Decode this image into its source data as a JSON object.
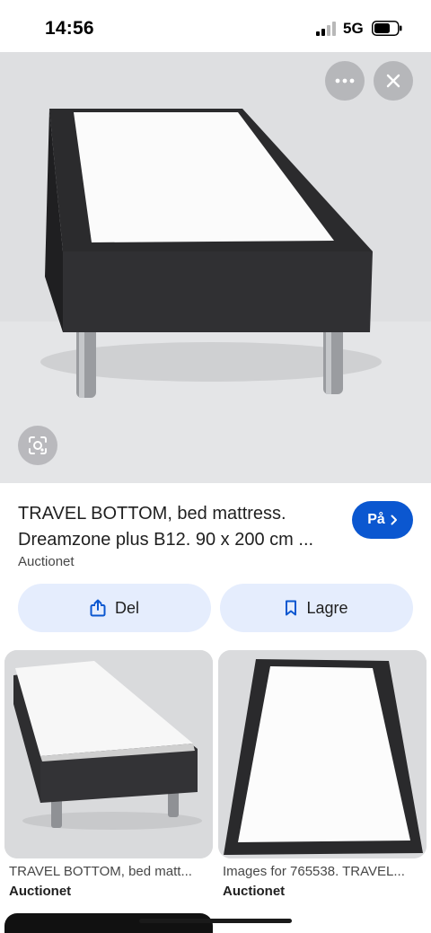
{
  "status_bar": {
    "time": "14:56",
    "network": "5G",
    "icons": [
      "signal-icon",
      "battery-icon"
    ]
  },
  "hero": {
    "icons": [
      "more-icon",
      "close-icon",
      "lens-icon"
    ]
  },
  "result": {
    "title_line1": "TRAVEL BOTTOM, bed mattress.",
    "title_line2": "Dreamzone plus B12. 90 x 200 cm ...",
    "source": "Auctionet",
    "visit_label": "På"
  },
  "actions": {
    "share_label": "Del",
    "save_label": "Lagre"
  },
  "related": [
    {
      "caption": "TRAVEL BOTTOM, bed matt...",
      "source": "Auctionet"
    },
    {
      "caption": "Images for 765538. TRAVEL...",
      "source": "Auctionet"
    }
  ],
  "colors": {
    "accent": "#0b57d0",
    "chip_background": "#e5edfd"
  }
}
